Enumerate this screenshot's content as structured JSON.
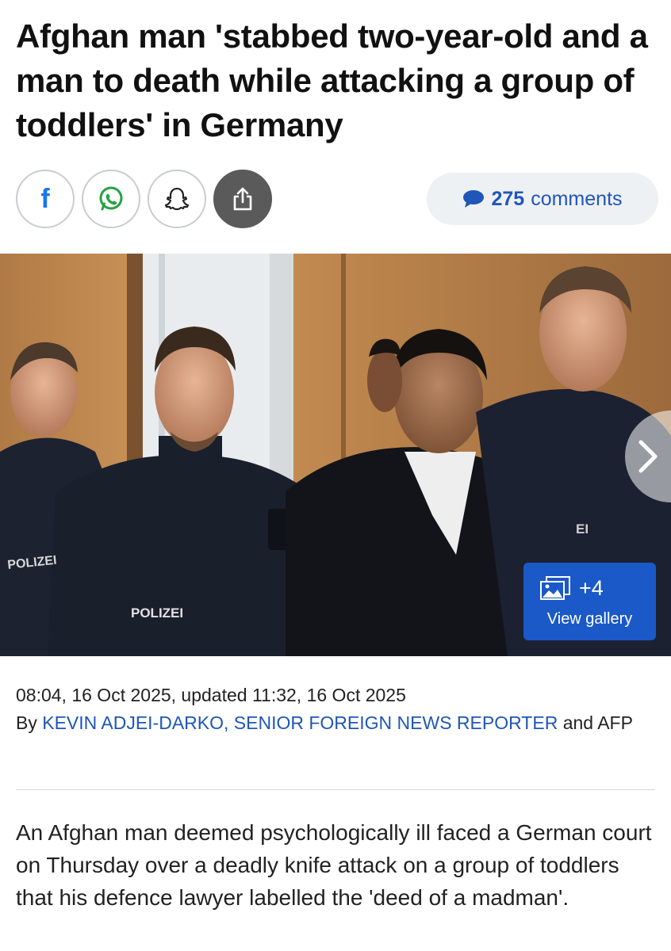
{
  "article": {
    "headline": "Afghan man 'stabbed two-year-old and a man to death while attacking a group of toddlers' in Germany",
    "share": {
      "facebook_icon": "facebook-icon",
      "whatsapp_icon": "whatsapp-icon",
      "snapchat_icon": "snapchat-icon",
      "share_icon": "share-icon"
    },
    "comments": {
      "count": "275",
      "label": "comments",
      "icon": "speech-bubble-icon"
    },
    "image": {
      "polizei_left": "POLIZEI",
      "polizei_center": "POLIZEI",
      "polizei_right_partial": "EI",
      "gallery_count": "+4",
      "gallery_label": "View gallery",
      "next_icon": "chevron-right-icon"
    },
    "timestamp": "08:04, 16 Oct 2025, updated 11:32, 16 Oct 2025",
    "byline_prefix": "By",
    "author": "KEVIN ADJEI-DARKO, SENIOR FOREIGN NEWS REPORTER",
    "byline_suffix": "and AFP",
    "lead": "An Afghan man deemed psychologically ill faced a German court on Thursday over a deadly knife attack on a group of toddlers that his defence lawyer labelled the 'deed of a madman'."
  },
  "colors": {
    "link": "#1f56b8",
    "gallery_button": "#1a59c7",
    "facebook": "#1877f2",
    "whatsapp": "#25a244"
  }
}
